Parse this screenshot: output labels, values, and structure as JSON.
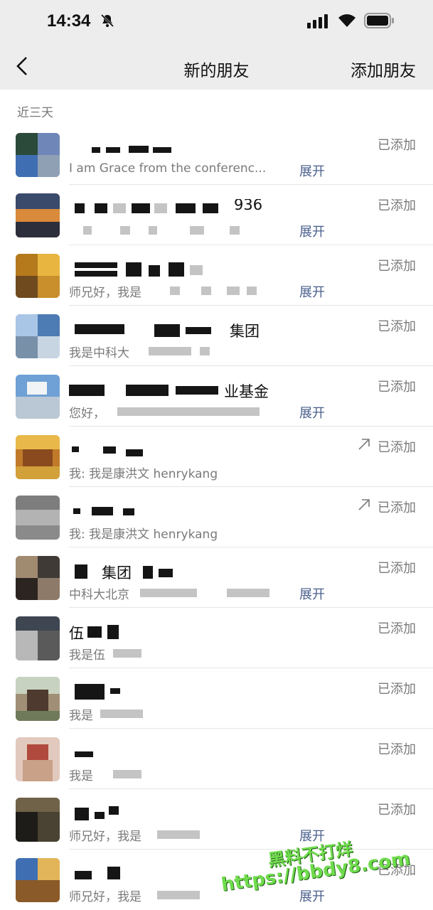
{
  "status_bar": {
    "time": "14:34"
  },
  "nav": {
    "title": "新的朋友",
    "action": "添加朋友"
  },
  "section_label": "近三天",
  "rows": [
    {
      "name": "",
      "message": "I am Grace from the conferenc...",
      "expand": "展开",
      "status": "已添加",
      "forwarded": false
    },
    {
      "name": "936",
      "message": "",
      "expand": "展开",
      "status": "已添加",
      "forwarded": false
    },
    {
      "name": "",
      "message": "师兄好，我是",
      "expand": "展开",
      "status": "已添加",
      "forwarded": false
    },
    {
      "name": "集团",
      "message": "我是中科大",
      "expand": "",
      "status": "已添加",
      "forwarded": false
    },
    {
      "name": "业基金",
      "message": "您好，",
      "expand": "展开",
      "status": "已添加",
      "forwarded": false
    },
    {
      "name": "",
      "message": "我: 我是康洪文 henrykang",
      "expand": "",
      "status": "已添加",
      "forwarded": true
    },
    {
      "name": "",
      "message": "我: 我是康洪文 henrykang",
      "expand": "",
      "status": "已添加",
      "forwarded": true
    },
    {
      "name": "集团",
      "message": "中科大北京",
      "expand": "展开",
      "status": "已添加",
      "forwarded": false
    },
    {
      "name": "伍",
      "message": "我是伍",
      "expand": "",
      "status": "已添加",
      "forwarded": false
    },
    {
      "name": "",
      "message": "我是",
      "expand": "",
      "status": "已添加",
      "forwarded": false
    },
    {
      "name": "",
      "message": "我是",
      "expand": "",
      "status": "已添加",
      "forwarded": false
    },
    {
      "name": "",
      "message": "师兄好，我是",
      "expand": "展开",
      "status": "已添加",
      "forwarded": false
    },
    {
      "name": "",
      "message": "师兄好，我是",
      "expand": "展开",
      "status": "已添加",
      "forwarded": false
    }
  ],
  "watermark": {
    "line1": "黑料不打烊",
    "line2": "https://bbdy8.com"
  }
}
